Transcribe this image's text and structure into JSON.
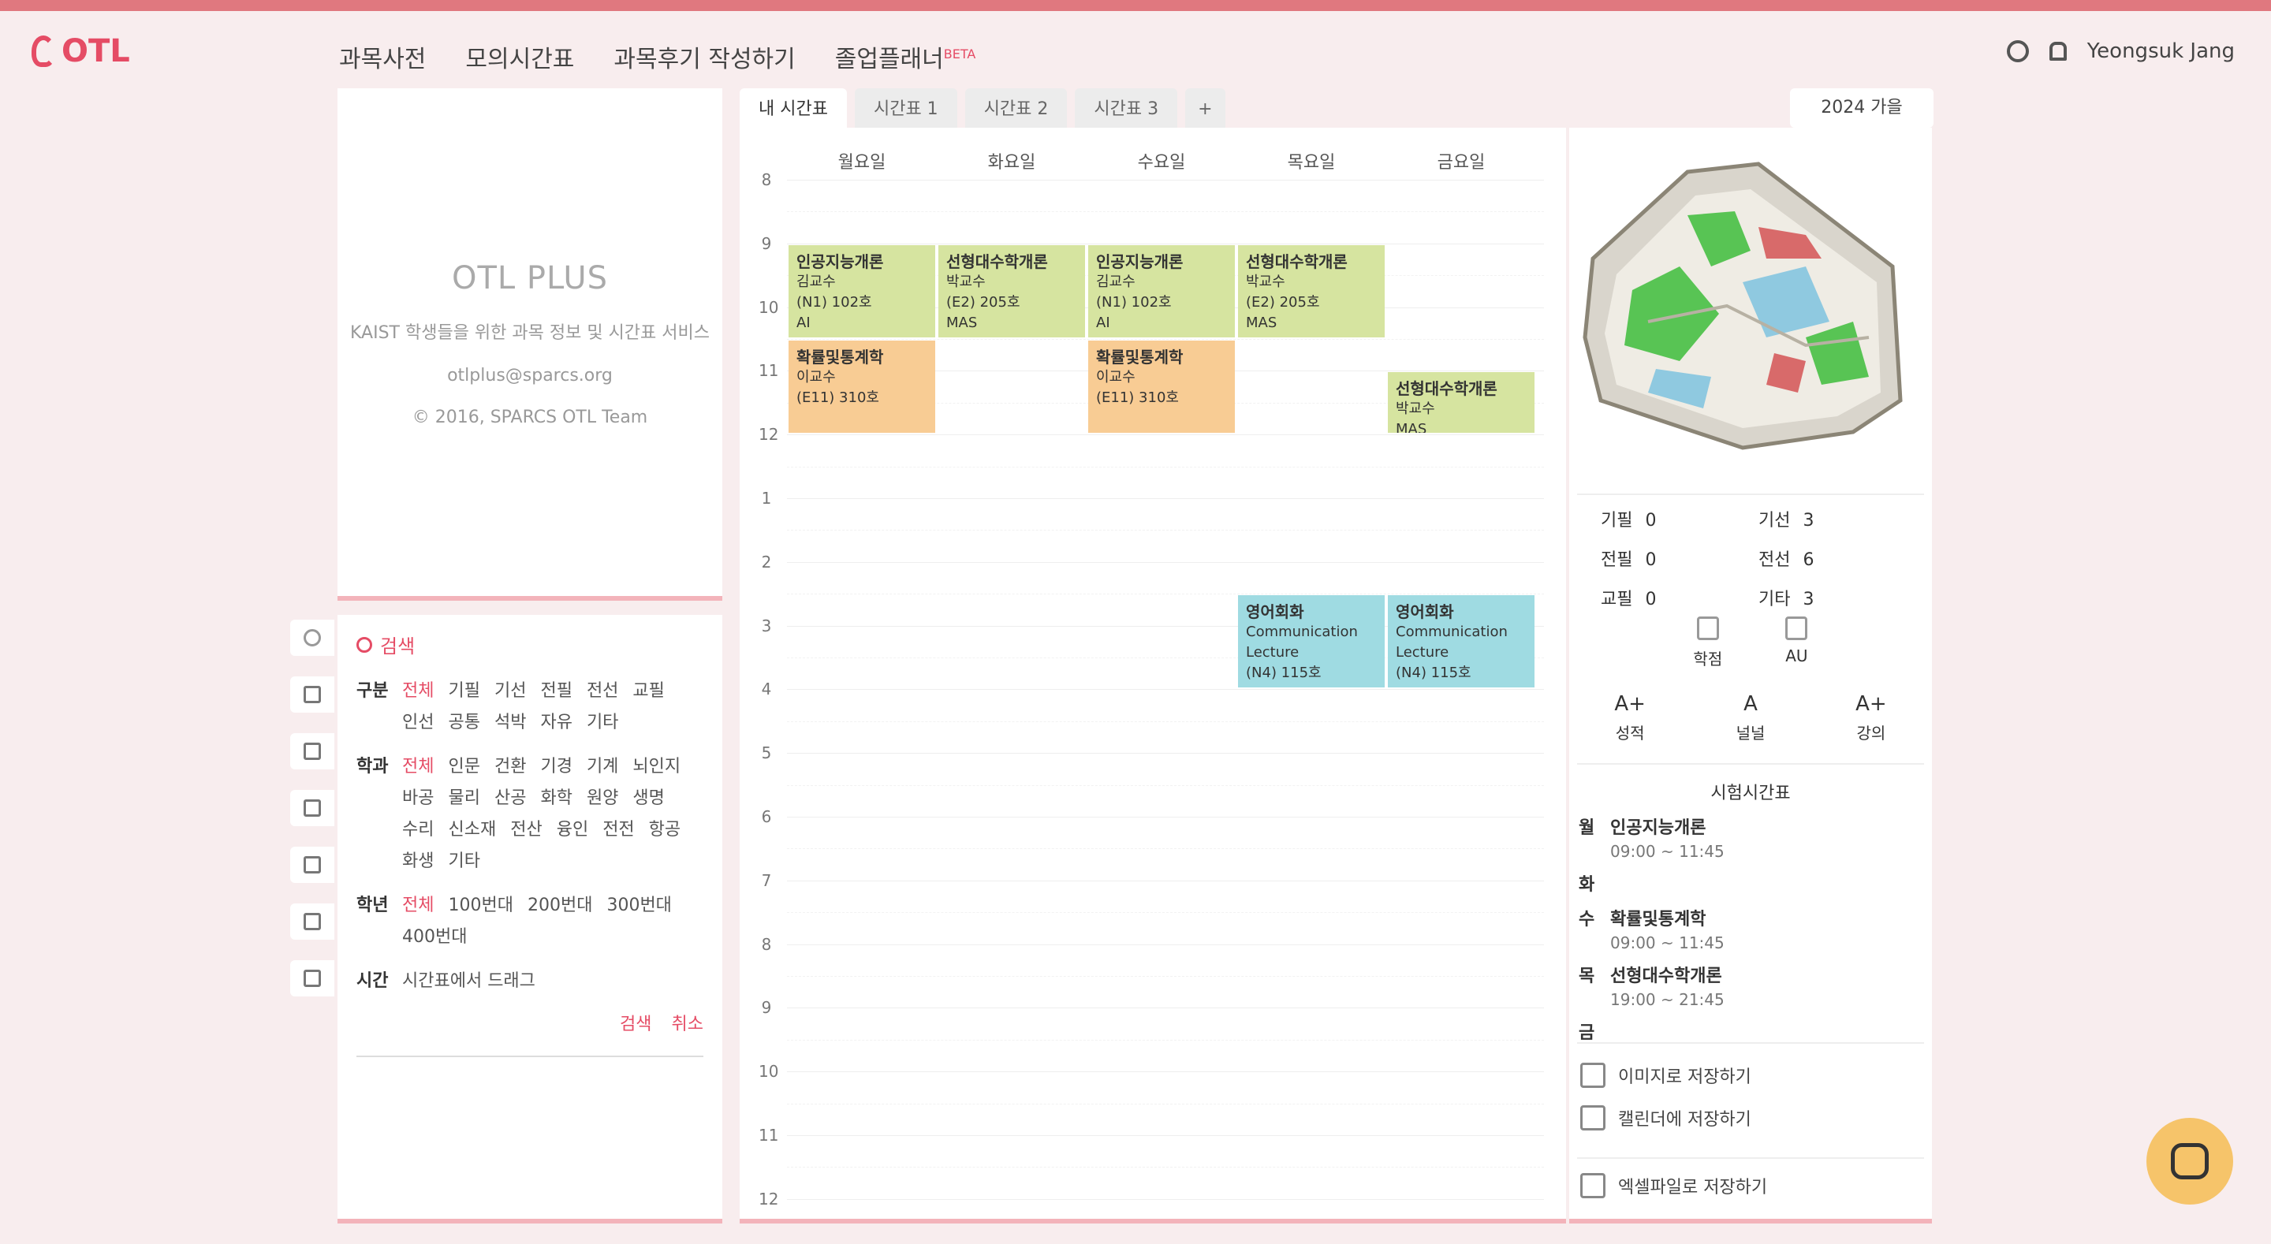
{
  "header": {
    "logo": "OTL",
    "nav": [
      {
        "label": "과목사전",
        "badge": ""
      },
      {
        "label": "모의시간표",
        "badge": ""
      },
      {
        "label": "과목후기 작성하기",
        "badge": ""
      },
      {
        "label": "졸업플래너",
        "badge": "BETA"
      }
    ],
    "user_name": "Yeongsuk Jang"
  },
  "info_card": {
    "title": "OTL PLUS",
    "lines": [
      "KAIST 학생들을 위한 과목 정보 및 시간표 서비스",
      "otlplus@sparcs.org",
      "© 2016, SPARCS OTL Team"
    ]
  },
  "search": {
    "header": "검색",
    "filters": [
      {
        "label": "구분",
        "options": [
          "전체",
          "기필",
          "기선",
          "전필",
          "전선",
          "교필",
          "인선",
          "공통",
          "석박",
          "자유",
          "기타"
        ]
      },
      {
        "label": "학과",
        "options": [
          "전체",
          "인문",
          "건환",
          "기경",
          "기계",
          "뇌인지",
          "바공",
          "물리",
          "산공",
          "화학",
          "원양",
          "생명",
          "수리",
          "신소재",
          "전산",
          "융인",
          "전전",
          "항공",
          "화생",
          "기타"
        ]
      },
      {
        "label": "학년",
        "options": [
          "전체",
          "100번대",
          "200번대",
          "300번대",
          "400번대"
        ]
      },
      {
        "label": "시간",
        "options": [
          "시간표에서 드래그"
        ]
      }
    ],
    "actions": [
      "검색",
      "취소"
    ]
  },
  "tabs": [
    "내 시간표",
    "시간표 1",
    "시간표 2",
    "시간표 3",
    "+"
  ],
  "semester": "2024 가을",
  "timetable": {
    "days": [
      "월요일",
      "화요일",
      "수요일",
      "목요일",
      "금요일"
    ],
    "hours": [
      "8",
      "9",
      "10",
      "11",
      "12",
      "1",
      "2",
      "3",
      "4",
      "5",
      "6",
      "7",
      "8",
      "9",
      "10",
      "11",
      "12"
    ],
    "blocks": [
      {
        "day": "월요일",
        "title": "인공지능개론",
        "lines": [
          "김교수",
          "(N1) 102호",
          "AI"
        ],
        "color": "#d6e4a0"
      },
      {
        "day": "화요일",
        "title": "선형대수학개론",
        "lines": [
          "박교수",
          "(E2) 205호",
          "MAS"
        ],
        "color": "#d6e4a0"
      },
      {
        "day": "수요일",
        "title": "인공지능개론",
        "lines": [
          "김교수",
          "(N1) 102호",
          "AI"
        ],
        "color": "#d6e4a0"
      },
      {
        "day": "목요일",
        "title": "선형대수학개론",
        "lines": [
          "박교수",
          "(E2) 205호",
          "MAS"
        ],
        "color": "#d6e4a0"
      },
      {
        "day": "월요일",
        "title": "확률및통계학",
        "lines": [
          "이교수",
          "(E11) 310호"
        ],
        "color": "#f8cc94"
      },
      {
        "day": "수요일",
        "title": "확률및통계학",
        "lines": [
          "이교수",
          "(E11) 310호"
        ],
        "color": "#f8cc94"
      },
      {
        "day": "금요일",
        "title": "선형대수학개론",
        "lines": [
          "박교수",
          "MAS"
        ],
        "color": "#d6e4a0"
      },
      {
        "day": "목요일",
        "title": "영어회화",
        "lines": [
          "Communication",
          "Lecture",
          "(N4) 115호"
        ],
        "color": "#9fdbe2"
      },
      {
        "day": "금요일",
        "title": "영어회화",
        "lines": [
          "Communication",
          "Lecture",
          "(N4) 115호"
        ],
        "color": "#9fdbe2"
      }
    ]
  },
  "summary": {
    "counts": [
      {
        "label": "기필",
        "value": "0"
      },
      {
        "label": "기선",
        "value": "3"
      },
      {
        "label": "전필",
        "value": "0"
      },
      {
        "label": "전선",
        "value": "6"
      },
      {
        "label": "교필",
        "value": "0"
      },
      {
        "label": "기타",
        "value": "3"
      }
    ],
    "stats": [
      {
        "label": "학점"
      },
      {
        "label": "AU"
      }
    ],
    "grades": [
      {
        "value": "A+",
        "label": "성적"
      },
      {
        "value": "A",
        "label": "널널"
      },
      {
        "value": "A+",
        "label": "강의"
      }
    ],
    "exam_title": "시험시간표",
    "exams": [
      {
        "day": "월",
        "title": "인공지능개론",
        "time": "09:00 ~ 11:45"
      },
      {
        "day": "화",
        "title": "",
        "time": ""
      },
      {
        "day": "수",
        "title": "확률및통계학",
        "time": "09:00 ~ 11:45"
      },
      {
        "day": "목",
        "title": "선형대수학개론",
        "time": "19:00 ~ 21:45"
      },
      {
        "day": "금",
        "title": "",
        "time": ""
      }
    ],
    "actions": [
      "이미지로 저장하기",
      "캘린더에 저장하기",
      "엑셀파일로 저장하기"
    ]
  }
}
